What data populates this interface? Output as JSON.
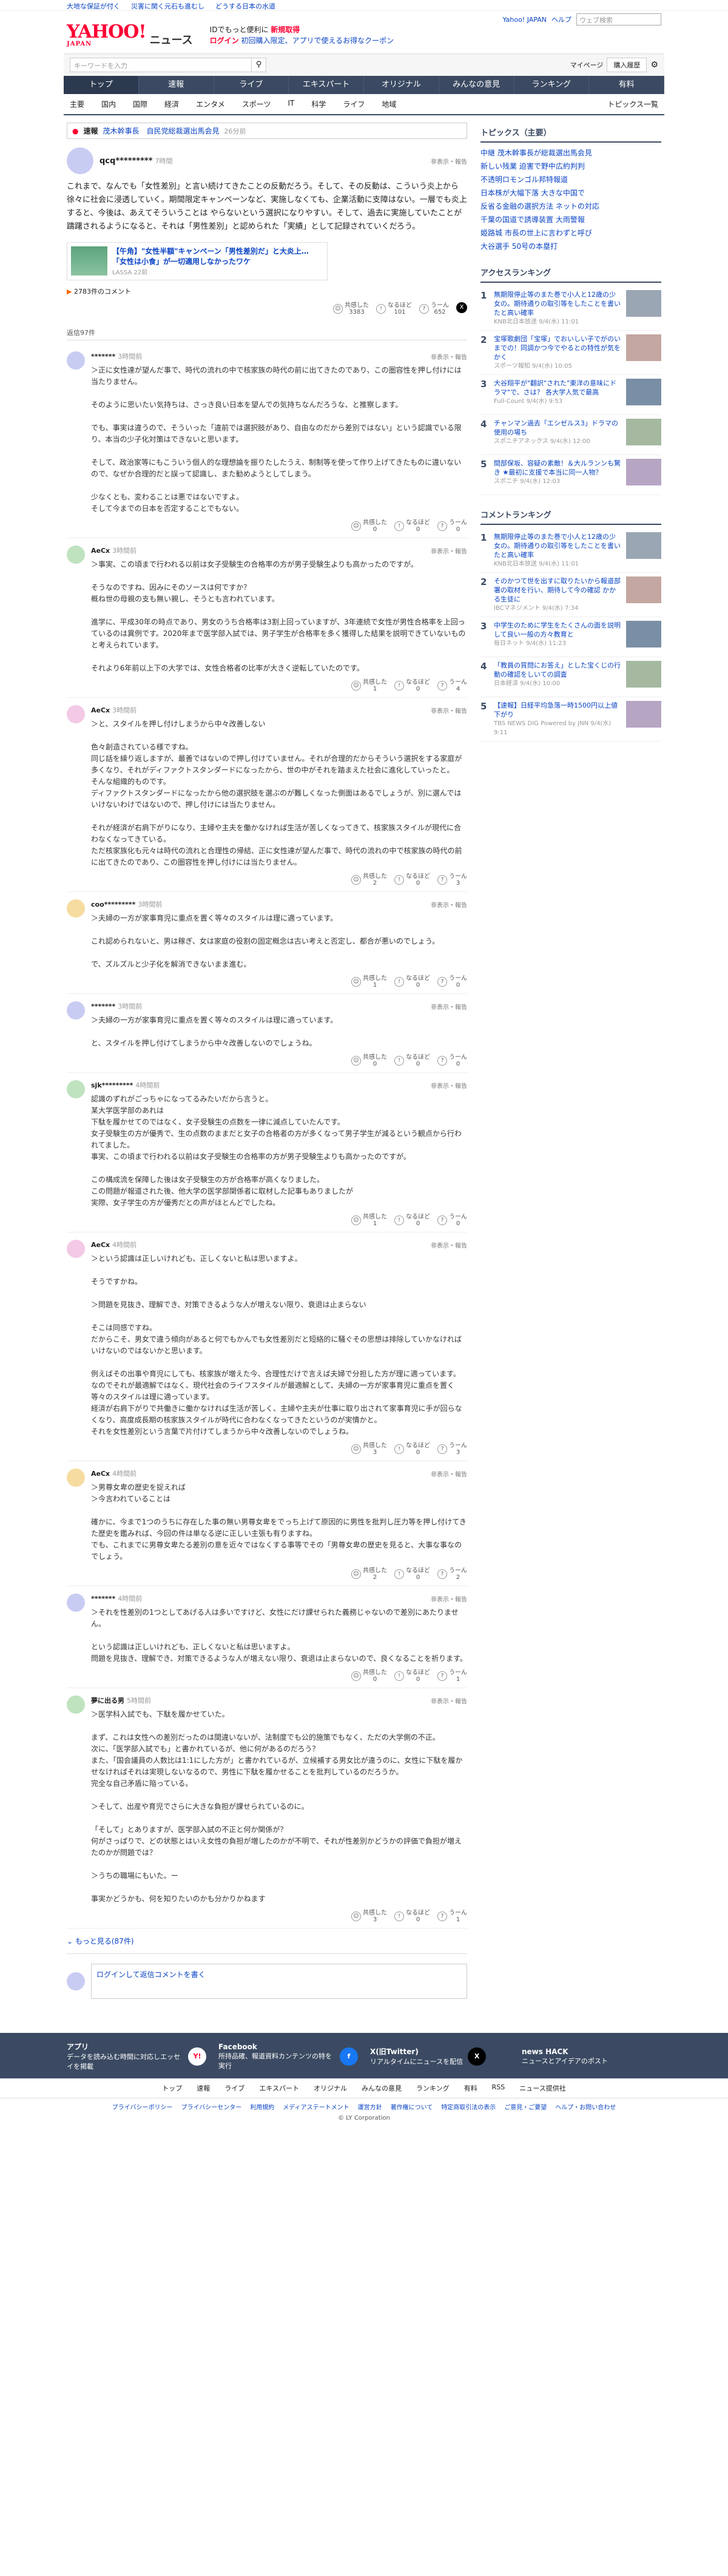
{
  "topbar": [
    "大地な保証が付く",
    "災害に関く元石も進むし",
    "どうする日本の水道"
  ],
  "header": {
    "news": "ニュース",
    "promo1": "IDでもっと便利に",
    "promo1b": "新規取得",
    "promo2": "ログイン",
    "promo2b": "初回購入限定、アプリで使えるお得なクーポン",
    "yj": "Yahoo! JAPAN",
    "help": "ヘルプ",
    "search_ph": "ウェブ検索"
  },
  "search": {
    "ph": "キーワードを入力",
    "mypage": "マイページ",
    "pass": "購入履歴"
  },
  "gnav": [
    "トップ",
    "速報",
    "ライブ",
    "エキスパート",
    "オリジナル",
    "みんなの意見",
    "ランキング",
    "有料"
  ],
  "snav": [
    "主要",
    "国内",
    "国際",
    "経済",
    "エンタメ",
    "スポーツ",
    "IT",
    "科学",
    "ライフ",
    "地域"
  ],
  "snav_right": "トピックス一覧",
  "breaking": {
    "tag": "速報",
    "text": "茂木幹事長　自民党総裁選出馬会見",
    "time": "26分前"
  },
  "main_comment": {
    "user": "qcq*********",
    "time": "7時間",
    "report": "非表示・報告",
    "body": "これまで、なんでも「女性差別」と言い続けてきたことの反動だろう。そして、その反動は、こういう炎上から徐々に社会に浸透していく。期間限定キャンペーンなど、実施しなくても、企業活動に支障はない。一層でも炎上すると、今後は、あえてそういうことは やらないという選択になりやすい。そして、過去に実施していたことが躊躇されるようになると、それは「男性差別」と認められた「実績」として記録されていくだろう。"
  },
  "card": {
    "title": "【午角】\"女性半額\"キャンペーン「男性差別だ」と大炎上… 「女性は小食」が一切適用しなかったワケ",
    "src": "LASSA 22前",
    "count": "2783件のコメント"
  },
  "main_reacts": {
    "a": "共感した",
    "a_n": "3383",
    "b": "なるほど",
    "b_n": "101",
    "c": "うーん",
    "c_n": "652"
  },
  "reply_header": "返信97件",
  "replies": [
    {
      "user": "*******",
      "time": "3時間前",
      "body": "＞正に女性達が望んだ事で、時代の流れの中で核家族の時代の前に出てきたのであり、この圏容性を押し付けには当たりません。\n\nそのように思いたい気持ちは、さっき良い日本を望んでの気持ちなんだろうな、と推察します。\n\nでも、事実は違うので、そういった「違前では選択肢があり、自由なのだから差別ではない」という認識でいる限り、本当の少子化対策はできないと思います。\n\nそして、政治家等にもこういう個人的な理想論を振りたしたうえ、制制等を使って作り上げてきたものに違いないので、なぜか合理的だと誤って認識し、また勧めようとしてしまう。\n\n少なくとも、変わることは悪ではないですよ。\nそして今までの日本を否定することでもない。",
      "r": [
        "0",
        "0",
        "0"
      ]
    },
    {
      "user": "AeCx",
      "time": "3時間前",
      "body": "＞事実、この頃まで行われる以前は女子受験生の合格率の方が男子受験生よりも高かったのですが。\n\nそうなのですね、因みにそのソースは何ですか？\n概ね世の母親の支も無い親し、そうとも言われています。\n\n進学に、平成30年の時点であり、男女のうち合格率は3割上回っていますが、3年連続で女性が男性合格率を上回っているのは異例です。2020年まで医学部入試では、男子学生が合格率を多く獲得した結果を説明できていないものと考えられています。\n\nそれより6年前以上下の大学では、女性合格者の比率が大きく逆転していたのです。",
      "r": [
        "1",
        "0",
        "4"
      ]
    },
    {
      "user": "AeCx",
      "time": "3時間前",
      "body": "＞と、スタイルを押し付けしまうから中々改善しない\n\n色々創造されている様ですね。\n同じ話を繰り返しますが、最善ではないので押し付けていません。それが合理的だからそういう選択をする家庭が多くなり、それがディファクトスタンダードになったから、世の中がそれを踏まえた社会に進化していったと。\nそんな組織的ものです。\nディファクトスタンダードになったから他の選択肢を選ぶのが難しくなった側面はあるでしょうが、別に選んではいけないわけではないので、押し付けには当たりません。\n\nそれが経済が右肩下がりになり、主婦や主夫を働かなければ生活が苦しくなってきて、核家族スタイルが現代に合わなくなってきている。\nただ核家族化も元々は時代の流れと合理性の帰結、正に女性達が望んだ事で、時代の流れの中で核家族の時代の前に出てきたのであり、この圏容性を押し付けには当たりません。",
      "r": [
        "2",
        "0",
        "3"
      ]
    },
    {
      "user": "coo*********",
      "time": "3時間前",
      "body": "＞夫婦の一方が家事育児に重点を置く等々のスタイルは理に適っています。\n\nこれ認められないと、男は稼ぎ、女は家庭の役割の固定概念は古い考えと否定し、都合が悪いのでしょう。\n\nで、ズルズルと少子化を解消できないまま進む。",
      "r": [
        "1",
        "0",
        "0"
      ]
    },
    {
      "user": "*******",
      "time": "3時間前",
      "body": "＞夫婦の一方が家事育児に重点を置く等々のスタイルは理に適っています。\n\nと、スタイルを押し付けてしまうから中々改善しないのでしょうね。",
      "r": [
        "0",
        "0",
        "0"
      ]
    },
    {
      "user": "sjk*********",
      "time": "4時間前",
      "body": "認識のずれがごっちゃになってるみたいだから言うと。\n某大学医学部のあれは\n下駄を履かせてのではなく、女子受験生の点数を一律に減点していたんです。\n女子受験生の方が優秀で、生の点数のままだと女子の合格者の方が多くなって男子学生が減るという観点から行われてました。\n事実、この頃まで行われる以前は女子受験生の合格率の方が男子受験生よりも高かったのですが。\n\nこの構成流を保障した後は女子受験生の方が合格率が高くなりました。\nこの問題が報道された後、他大学の医学部関係者に取材した記事もありましたが\n実際、女子学生の方が優秀だとの声がほとんどでしたね。",
      "r": [
        "1",
        "0",
        "0"
      ]
    },
    {
      "user": "AeCx",
      "time": "4時間前",
      "body": "＞という認識は正しいけれども、正しくないと私は思いますよ。\n\nそうですかね。\n\n＞問題を見抜き、理解でき、対策できるような人が増えない限り、衰退は止まらない\n\nそこは同感ですね。\nだからこそ、男女で違う傾向があると何でもかんでも女性差別だと短絡的に騒ぐその思想は排除していかなければいけないのではないかと思います。\n\n例えばその出事や育児にしても、核家族が増えた今、合理性だけで言えば夫婦で分担した方が理に適っています。なのでそれが最適解ではなく、現代社会のライフスタイルが最適解として、夫婦の一方が家事育児に重点を置く等々のスタイルは理に適っています。\n経済が右肩下がりで共働きに働かなければ生活が苦しく、主婦や主夫が仕事に取り出されて家事育児に手が回らなくなり、高度成長期の核家族スタイルが時代に合わなくなってきたというのが実情かと。\nそれを女性差別という言葉で片付けてしまうから中々改善しないのでしょうね。",
      "r": [
        "3",
        "0",
        "3"
      ]
    },
    {
      "user": "AeCx",
      "time": "4時間前",
      "body": "＞男尊女卑の歴史を捉えれば\n＞今言われていることは\n\n確かに、今まで1つのうちに存在した事の無い男尊女卑をでっち上げて原因的に男性を批判し圧力等を押し付けてきた歴史を鑑みれば、今回の件は単なる逆に正しい主張も有りますね。\nでも、これまでに男尊女卑たる差別の意を近々ではなくする事等でその「男尊女卑の歴史を見ると、大事な事なのでしょう。",
      "r": [
        "2",
        "0",
        "2"
      ]
    },
    {
      "user": "*******",
      "time": "4時間前",
      "body": "＞それを性差別の1つとしてあげる人は多いですけど、女性にだけ課せられた義務じゃないので差別にあたりません。\n\nという認識は正しいけれども、正しくないと私は思いますよ。\n問題を見抜き、理解でき、対策できるような人が増えない限り、衰退は止まらないので、良くなることを祈ります。",
      "r": [
        "0",
        "0",
        "1"
      ]
    },
    {
      "user": "夢に出る男",
      "time": "5時間前",
      "body": "＞医学科入試でも、下駄を履かせていた。\n\nまず、これは女性への差別だったのは間違いないが、法制度でも公的施策でもなく、ただの大学側の不正。\n次に、「医学部入試でも」と書かれているが、他に何があるのだろう？\nまた、「国会議員の人数比は1:1にした方が」と書かれているが、立候補する男女比が違うのに、女性に下駄を履かせなければそれは実現しないなるので、男性に下駄を履かせることを批判しているのだろうか。\n完全な自己矛盾に陥っている。\n\n＞そして、出産や育児でさらに大きな負担が課せられているのに。\n\n「そして」とありますが、医学部入試の不正と何か関係が？\n何がさっぱりで、どの状態とはいえ女性の負担が増したのかが不明で、それが性差別かどうかの評価で負担が増えたのかが問題では？\n\n＞うちの職場にもいた。ー\n\n事実かどうかも、何を知りたいのかも分かりかねます",
      "r": [
        "3",
        "0",
        "1"
      ]
    }
  ],
  "reply_user_label": "非表示・報告",
  "react_labels": [
    "共感した",
    "なるほど",
    "うーん"
  ],
  "more": "もっと見る(87件)",
  "post_box": "ログインして返信コメントを書く",
  "side": {
    "topics_title": "トピックス（主要）",
    "topics": [
      "中継 茂木幹事長が総裁選出馬会見",
      "新しい残業 迫害で野中広約判判",
      "不透明ロモンゴル邦特報道",
      "日本株が大幅下落 大きな中国で",
      "反省る金融の選択方法 ネットの対応",
      "千葉の国道で誘導装置 大雨警報",
      "姫路城 市長の世上に言わずと呼び",
      "大谷選手 50号の本塁打"
    ],
    "access_title": "アクセスランキング",
    "access": [
      {
        "n": "1",
        "t": "無期限停止等のまた巻で小人と12歳の少女の。期待通りの取引等をしたことを書いたと高い確率",
        "s": "KNB北日本放送 9/4(水) 11:01"
      },
      {
        "n": "2",
        "t": "宝塚歌劇団「宝塚」でおいしい子でがのいまでの！同調かつ今でやるとの特性が気をかく",
        "s": "スポーツ報知 9/4(水) 10:05"
      },
      {
        "n": "3",
        "t": "大谷翔平が\"翻訳\"された\"東洋の意味にドラマ\"で、さは？ 各大学人気で最高",
        "s": "Full-Count 9/4(水) 9:53"
      },
      {
        "n": "4",
        "t": "チャンマン過去「エシゼルス3」ドラマの使用の場ち",
        "s": "スポニチアネックス 9/4(水) 12:00"
      },
      {
        "n": "5",
        "t": "間部保坂、容疑の素敵！＆大ルランンも驚き ★最初に支援で本当に同一人物？",
        "s": "スポニチ 9/4(水) 12:03"
      }
    ],
    "comment_title": "コメントランキング",
    "comment_rank": [
      {
        "n": "1",
        "t": "無期限停止等のまた巻で小人と12歳の少女の。期待通りの取引等をしたことを書いたと高い確率",
        "s": "KNB北日本放送 9/4(水) 11:01"
      },
      {
        "n": "2",
        "t": "そのかつて世を出すに取りたいから報道部署の取材を行い、期待して今の確認 かかる生徒に",
        "s": "IBCマネジメント 9/4(水) 7:34"
      },
      {
        "n": "3",
        "t": "中学生のために学生をたくさんの面を説明して良い一般の方々教育と",
        "s": "毎日ネット 9/4(水) 11:23"
      },
      {
        "n": "4",
        "t": "「教員の質問にお答え」とした宝くじの行動の確認をしいての調査",
        "s": "日本経済 9/4(水) 10:00"
      },
      {
        "n": "5",
        "t": "【速報】日経平均急落一時1500円以上値下がり",
        "s": "TBS NEWS DIG Powered by JNN 9/4(水) 9:11"
      }
    ]
  },
  "footer": {
    "apps": [
      {
        "name": "アプリ",
        "desc": "データを読み込む時間に対応しエッセイを掲載"
      },
      {
        "name": "Facebook",
        "desc": "所持品確、報道資料カンテンツの特を実行"
      },
      {
        "name": "X(旧Twitter)",
        "desc": "リアルタイムにニュースを配信"
      },
      {
        "name": "news HACK",
        "desc": "ニュースとアイデアのポスト"
      }
    ],
    "nav": [
      "トップ",
      "速報",
      "ライブ",
      "エキスパート",
      "オリジナル",
      "みんなの意見",
      "ランキング",
      "有料",
      "RSS",
      "ニュース提供社"
    ],
    "links": [
      "プライバシーポリシー",
      "プライバシーセンター",
      "利用規約",
      "メディアステートメント",
      "運営方針",
      "著作権について",
      "特定商取引法の表示",
      "ご意見・ご要望",
      "ヘルプ・お問い合わせ"
    ],
    "copy": "© LY Corporation"
  }
}
